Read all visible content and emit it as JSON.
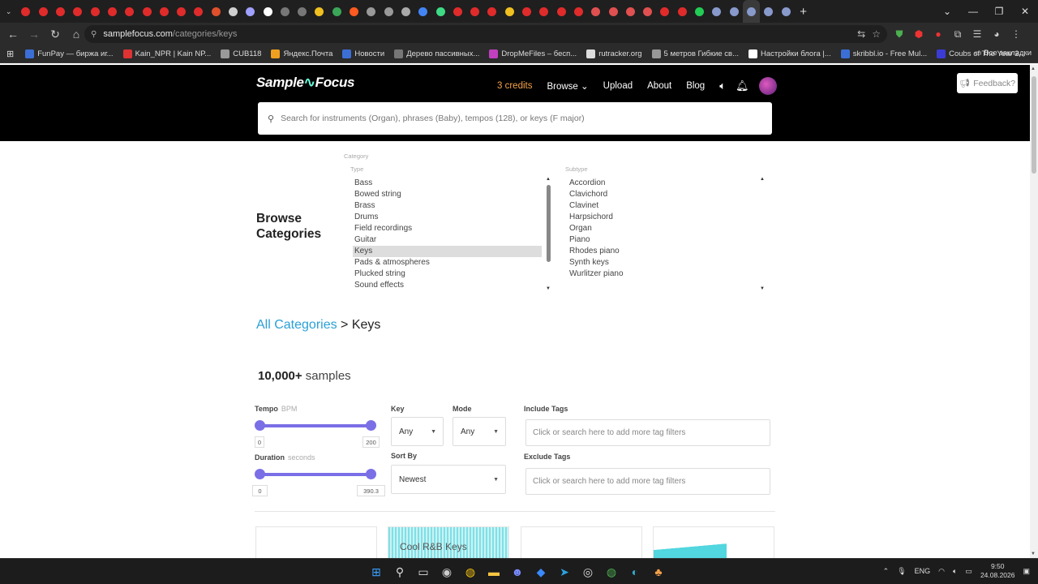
{
  "browser": {
    "tab_colors": [
      "#e02b2b",
      "#e02b2b",
      "#e02b2b",
      "#e02b2b",
      "#e02b2b",
      "#e02b2b",
      "#e02b2b",
      "#e02b2b",
      "#e02b2b",
      "#e02b2b",
      "#e02b2b",
      "#e0502b",
      "#cfcfcf",
      "#a0a0ff",
      "#ffffff",
      "#777777",
      "#777777",
      "#f0c020",
      "#3aa757",
      "#ff5a1f",
      "#999999",
      "#999999",
      "#aaaaaa",
      "#4285f4",
      "#3ddc84",
      "#e02b2b",
      "#e02b2b",
      "#e02b2b",
      "#f0c020",
      "#e02b2b",
      "#e02b2b",
      "#e02b2b",
      "#e02b2b",
      "#e05050",
      "#e05050",
      "#e05050",
      "#e05050",
      "#e02b2b",
      "#e02b2b",
      "#22cc55",
      "#8899cc",
      "#8899cc",
      "#8899cc",
      "#8899cc",
      "#8899cc"
    ],
    "url_host": "samplefocus.com",
    "url_path": "/categories/keys",
    "bookmarks": [
      {
        "label": "FunPay — биржа иг...",
        "color": "#3b6fd6"
      },
      {
        "label": "Kain_NPR | Kain NP...",
        "color": "#d33"
      },
      {
        "label": "CUB118",
        "color": "#999"
      },
      {
        "label": "Яндекс.Почта",
        "color": "#f0a020"
      },
      {
        "label": "Новости",
        "color": "#3b6fd6"
      },
      {
        "label": "Дерево пассивных...",
        "color": "#777"
      },
      {
        "label": "DropMeFiles – бесп...",
        "color": "#c040c0"
      },
      {
        "label": "rutracker.org",
        "color": "#ddd"
      },
      {
        "label": "5 метров Гибкие св...",
        "color": "#999"
      },
      {
        "label": "Настройки блога |...",
        "color": "#fff"
      },
      {
        "label": "skribbl.io - Free Mul...",
        "color": "#3b6fd6"
      },
      {
        "label": "Coubs of The Year 2...",
        "color": "#3b3bd6"
      }
    ],
    "all_bookmarks": "Все закладки"
  },
  "header": {
    "logo_left": "Sample",
    "logo_wave": "∿",
    "logo_right": "Focus",
    "credits": "3 credits",
    "nav_browse": "Browse",
    "nav_upload": "Upload",
    "nav_about": "About",
    "nav_blog": "Blog",
    "feedback": "Feedback?",
    "search_placeholder": "Search for instruments (Organ), phrases (Baby), tempos (128), or keys (F major)"
  },
  "browse": {
    "title_line1": "Browse",
    "title_line2": "Categories",
    "category_label": "Category",
    "type_label": "Type",
    "subtype_label": "Subtype",
    "types": [
      "Bass",
      "Bowed string",
      "Brass",
      "Drums",
      "Field recordings",
      "Guitar",
      "Keys",
      "Pads & atmospheres",
      "Plucked string",
      "Sound effects"
    ],
    "selected_type": "Keys",
    "subtypes": [
      "Accordion",
      "Clavichord",
      "Clavinet",
      "Harpsichord",
      "Organ",
      "Piano",
      "Rhodes piano",
      "Synth keys",
      "Wurlitzer piano"
    ]
  },
  "breadcrumb": {
    "all": "All Categories",
    "sep": " > ",
    "current": "Keys"
  },
  "results": {
    "count": "10,000+",
    "suffix": " samples"
  },
  "filters": {
    "tempo_label": "Tempo",
    "tempo_unit": "BPM",
    "tempo_min": "0",
    "tempo_max": "200",
    "duration_label": "Duration",
    "duration_unit": "seconds",
    "duration_min": "0",
    "duration_max": "390.3",
    "key_label": "Key",
    "key_value": "Any",
    "mode_label": "Mode",
    "mode_value": "Any",
    "sort_label": "Sort By",
    "sort_value": "Newest",
    "include_label": "Include Tags",
    "include_placeholder": "Click or search here to add more tag filters",
    "exclude_label": "Exclude Tags",
    "exclude_placeholder": "Click or search here to add more tag filters"
  },
  "cards": [
    {
      "title": ""
    },
    {
      "title": "Cool R&B Keys"
    },
    {
      "title": ""
    },
    {
      "title": ""
    }
  ],
  "taskbar": {
    "lang": "ENG",
    "time": "9:50",
    "date": "24.08.2026"
  },
  "colors": {
    "accent_purple": "#7b6fe6",
    "link_blue": "#2aa0d6",
    "credits_orange": "#f7a14a"
  }
}
